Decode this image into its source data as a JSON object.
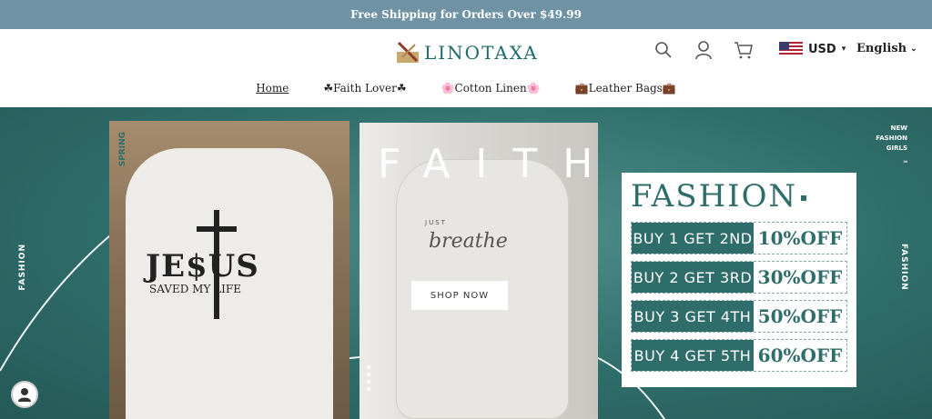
{
  "announcement": "Free Shipping for Orders Over $49.99",
  "brand": {
    "name": "LINOTAXA"
  },
  "header": {
    "currency": "USD",
    "language": "English"
  },
  "nav": [
    {
      "label": "Home"
    },
    {
      "label": "☘Faith Lover☘"
    },
    {
      "label": "🌸Cotton Linen🌸"
    },
    {
      "label": "💼Leather Bags💼"
    }
  ],
  "hero": {
    "side_left": "FASHION",
    "side_right": "FASHION",
    "new_fashion": [
      "NEW",
      "FASHION",
      "GIRLS"
    ],
    "spring": "SPRING",
    "shirt1_title": "JE$US",
    "shirt1_sub": "SAVED  MY  LIFE",
    "faith_word": "FAITH",
    "just": "JUST",
    "breathe": "breathe",
    "shop_now": "SHOP NOW",
    "card_title": "FASHION",
    "offers": [
      {
        "buy": "BUY 1 GET 2ND",
        "off": "10%OFF"
      },
      {
        "buy": "BUY 2 GET 3RD",
        "off": "30%OFF"
      },
      {
        "buy": "BUY 3 GET 4TH",
        "off": "50%OFF"
      },
      {
        "buy": "BUY 4 GET 5TH",
        "off": "60%OFF"
      }
    ]
  },
  "colors": {
    "announce_bg": "#6f93a5",
    "teal": "#2f6d6a"
  },
  "icons": [
    "search-icon",
    "account-icon",
    "cart-icon",
    "flag-usa-icon",
    "chevron-down-icon",
    "chat-icon"
  ]
}
